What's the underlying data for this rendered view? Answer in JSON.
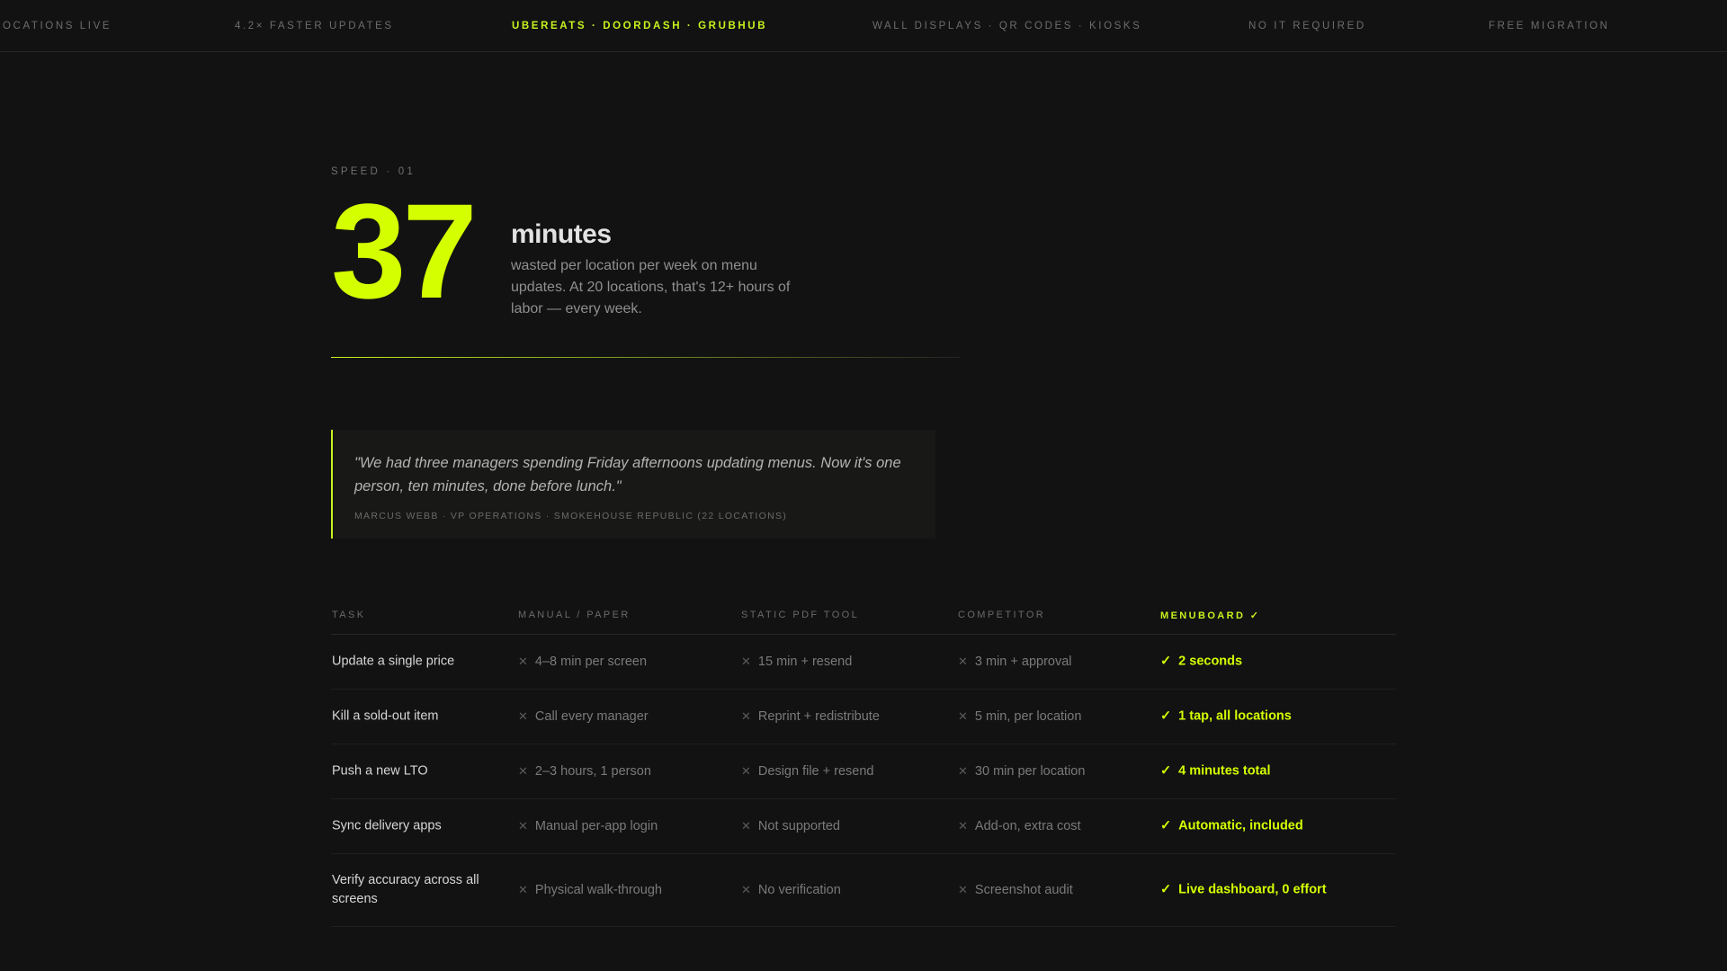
{
  "ticker": {
    "items": [
      {
        "text": "OCATIONS LIVE",
        "accent": false
      },
      {
        "text": "4.2× FASTER UPDATES",
        "accent": false
      },
      {
        "text": "UBEREATS · DOORDASH · GRUBHUB",
        "accent": true
      },
      {
        "text": "WALL DISPLAYS · QR CODES · KIOSKS",
        "accent": false
      },
      {
        "text": "NO IT REQUIRED",
        "accent": false
      },
      {
        "text": "FREE MIGRATION",
        "accent": false
      }
    ]
  },
  "stat": {
    "eyebrow": "SPEED · 01",
    "number": "37",
    "unit": "minutes",
    "description": "wasted per location per week on menu updates. At 20 locations, that's 12+ hours of labor — every week."
  },
  "quote": {
    "text": "\"We had three managers spending Friday afternoons updating menus. Now it's one person, ten minutes, done before lunch.\"",
    "attribution": "MARCUS WEBB · VP OPERATIONS · SMOKEHOUSE REPUBLIC (22 LOCATIONS)"
  },
  "comparison": {
    "headers": [
      "TASK",
      "MANUAL / PAPER",
      "STATIC PDF TOOL",
      "COMPETITOR",
      "MENUBOARD ✓"
    ],
    "neg_mark": "✕",
    "pos_mark": "✓",
    "rows": [
      {
        "task": "Update a single price",
        "manual": "4–8 min per screen",
        "pdf": "15 min + resend",
        "competitor": "3 min + approval",
        "menuboard": "2 seconds"
      },
      {
        "task": "Kill a sold-out item",
        "manual": "Call every manager",
        "pdf": "Reprint + redistribute",
        "competitor": "5 min, per location",
        "menuboard": "1 tap, all locations"
      },
      {
        "task": "Push a new LTO",
        "manual": "2–3 hours, 1 person",
        "pdf": "Design file + resend",
        "competitor": "30 min per location",
        "menuboard": "4 minutes total"
      },
      {
        "task": "Sync delivery apps",
        "manual": "Manual per-app login",
        "pdf": "Not supported",
        "competitor": "Add-on, extra cost",
        "menuboard": "Automatic, included"
      },
      {
        "task": "Verify accuracy across all screens",
        "manual": "Physical walk-through",
        "pdf": "No verification",
        "competitor": "Screenshot audit",
        "menuboard": "Live dashboard, 0 effort"
      }
    ]
  },
  "colors": {
    "background": "#121212",
    "accent": "#d4ff00"
  }
}
